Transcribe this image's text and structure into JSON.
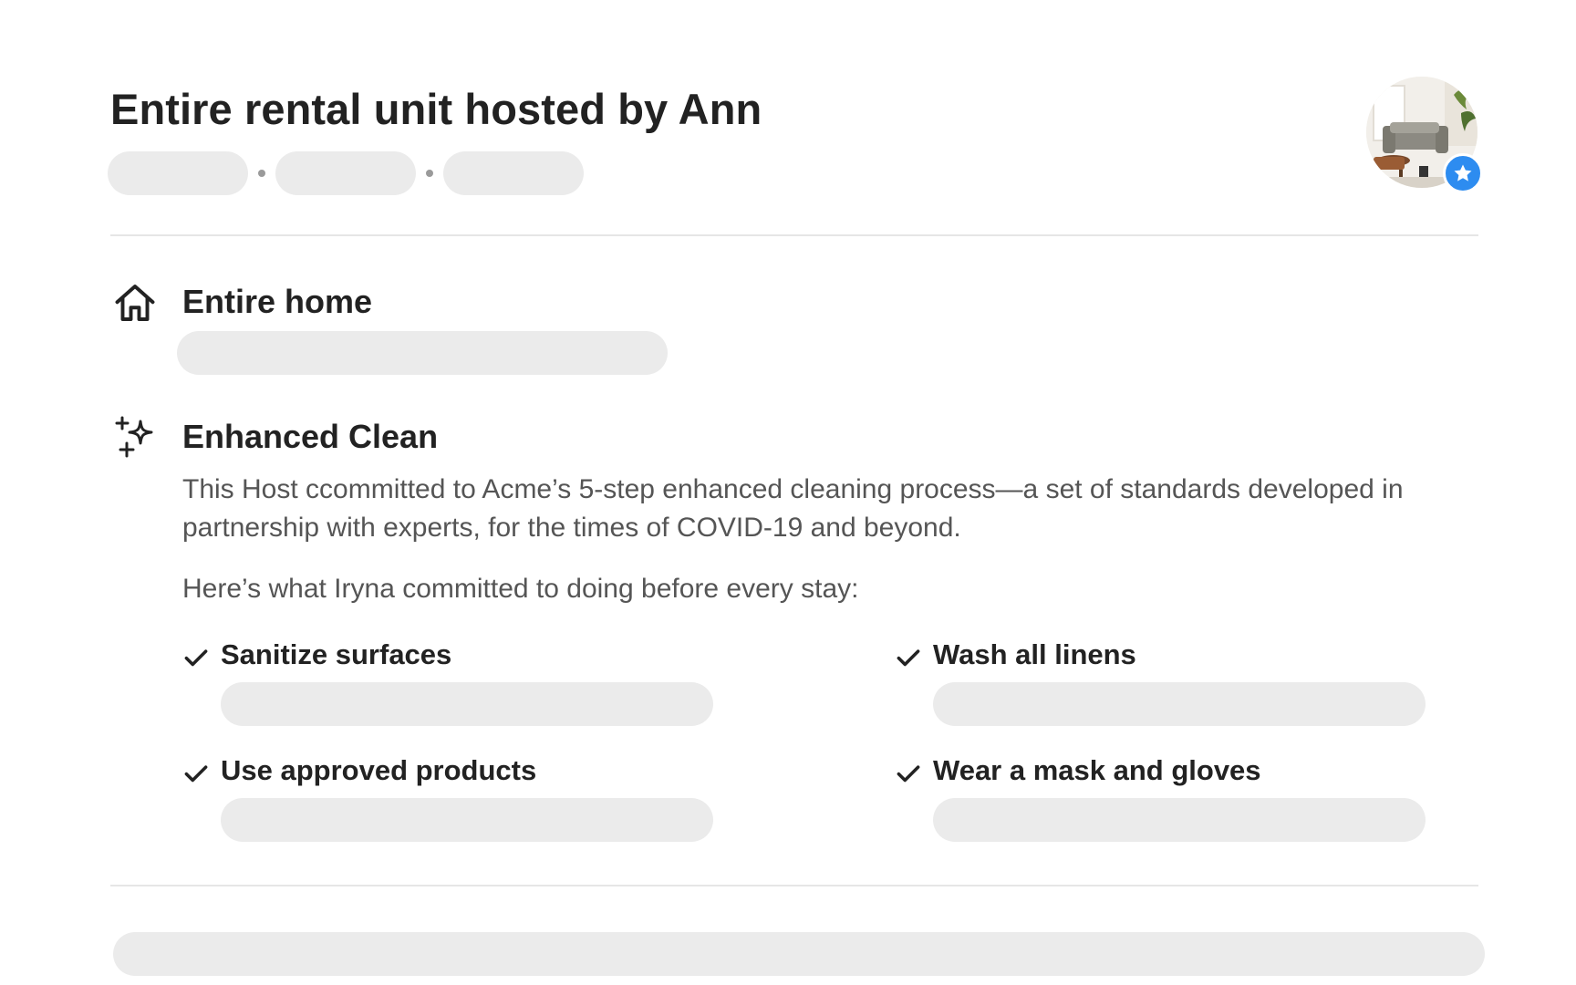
{
  "listing": {
    "title": "Entire rental unit hosted by Ann"
  },
  "host": {
    "avatar_icon": "host-avatar",
    "badge_icon": "star-icon",
    "badge_color": "#2d8cf0"
  },
  "features": {
    "home": {
      "icon": "home-icon",
      "heading": "Entire home"
    },
    "clean": {
      "icon": "sparkles-icon",
      "heading": "Enhanced Clean",
      "description": "This Host ccommitted to Acme’s 5-step enhanced cleaning process—a set of standards developed in partnership with experts, for the times of COVID-19 and beyond.",
      "commitment_intro": "Here’s what Iryna committed to doing before every stay:",
      "commitments": [
        "Sanitize surfaces",
        "Wash all linens",
        "Use approved products",
        "Wear a mask and gloves"
      ]
    }
  },
  "colors": {
    "text_primary": "#222222",
    "text_secondary": "#555555",
    "placeholder": "#ebebeb",
    "divider": "#e6e6e6"
  }
}
